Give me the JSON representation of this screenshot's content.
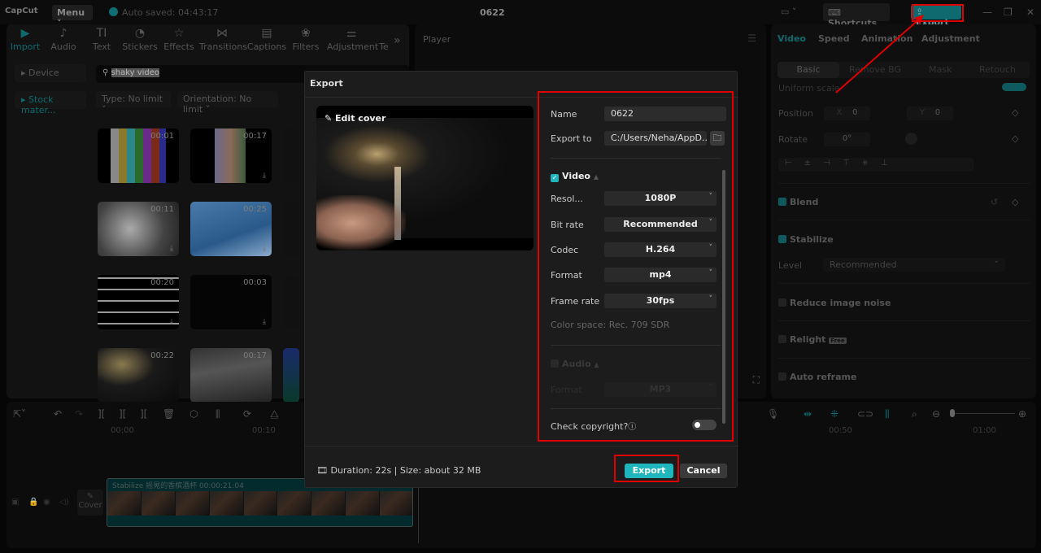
{
  "titlebar": {
    "app_name": "CapCut",
    "menu_label": "Menu ˅",
    "autosave_text": "Auto saved: 04:43:17",
    "project_title": "0622",
    "layout_icon": "▭ ˅",
    "shortcuts_label": "Shortcuts",
    "export_label": "Export",
    "window_controls": [
      "—",
      "❐",
      "✕"
    ]
  },
  "toolbar": {
    "tabs": [
      {
        "label": "Import",
        "icon": "▶",
        "active": true
      },
      {
        "label": "Audio",
        "icon": "♪"
      },
      {
        "label": "Text",
        "icon": "TI"
      },
      {
        "label": "Stickers",
        "icon": "◔"
      },
      {
        "label": "Effects",
        "icon": "☆"
      },
      {
        "label": "Transitions",
        "icon": "⋈"
      },
      {
        "label": "Captions",
        "icon": "▤"
      },
      {
        "label": "Filters",
        "icon": "❀"
      },
      {
        "label": "Adjustment",
        "icon": "⚌"
      },
      {
        "label": "Te",
        "icon": ""
      }
    ],
    "more_icon": "»"
  },
  "media": {
    "sidebar": [
      {
        "label": "▸ Device"
      },
      {
        "label": "▸ Stock mater..."
      }
    ],
    "search_value": "shaky video",
    "filters": [
      "Type: No limit ˅",
      "Orientation: No limit ˅"
    ],
    "thumbnails": [
      {
        "duration": "00:01"
      },
      {
        "duration": "00:17"
      },
      {
        "duration": "00:11"
      },
      {
        "duration": "00:25"
      },
      {
        "duration": "00:20"
      },
      {
        "duration": "00:03"
      },
      {
        "duration": "00:22"
      },
      {
        "duration": "00:17"
      }
    ]
  },
  "player": {
    "title": "Player"
  },
  "inspector": {
    "tabs": [
      "Video",
      "Speed",
      "Animation",
      "Adjustment"
    ],
    "subtabs": [
      "Basic",
      "Remove BG",
      "Mask",
      "Retouch"
    ],
    "uniform_scale": "Uniform scale",
    "position_label": "Position",
    "position_x_label": "X",
    "position_x": "0",
    "position_y_label": "Y",
    "position_y": "0",
    "rotate_label": "Rotate",
    "rotate_value": "0°",
    "blend_label": "Blend",
    "stabilize_label": "Stabilize",
    "level_label": "Level",
    "level_value": "Recommended",
    "reduce_noise_label": "Reduce image noise",
    "relight_label": "Relight",
    "relight_badge": "Free",
    "auto_reframe_label": "Auto reframe"
  },
  "timeline": {
    "marks": [
      "00:00",
      "00:10",
      "00:50",
      "01:00"
    ],
    "clip_label": "Stabilize  摇晃的香槟酒杯  00:00:21:04",
    "cover_label": "Cover"
  },
  "export_dialog": {
    "title": "Export",
    "edit_cover_label": "Edit cover",
    "name_label": "Name",
    "name_value": "0622",
    "export_to_label": "Export to",
    "export_to_value": "C:/Users/Neha/AppD...",
    "video_section_label": "Video",
    "video_enabled": true,
    "resolution_label": "Resol...",
    "resolution_value": "1080P",
    "bitrate_label": "Bit rate",
    "bitrate_value": "Recommended",
    "codec_label": "Codec",
    "codec_value": "H.264",
    "format_label": "Format",
    "format_value": "mp4",
    "framerate_label": "Frame rate",
    "framerate_value": "30fps",
    "color_space_text": "Color space: Rec. 709 SDR",
    "audio_section_label": "Audio",
    "audio_enabled": false,
    "audio_format_label": "Format",
    "audio_format_value": "MP3",
    "check_copyright_label": "Check copyright?",
    "check_copyright_on": false,
    "footer_info": "Duration: 22s | Size: about 32 MB",
    "export_button": "Export",
    "cancel_button": "Cancel"
  },
  "colors": {
    "accent": "#1fb5bd",
    "annotation": "#e00000"
  }
}
